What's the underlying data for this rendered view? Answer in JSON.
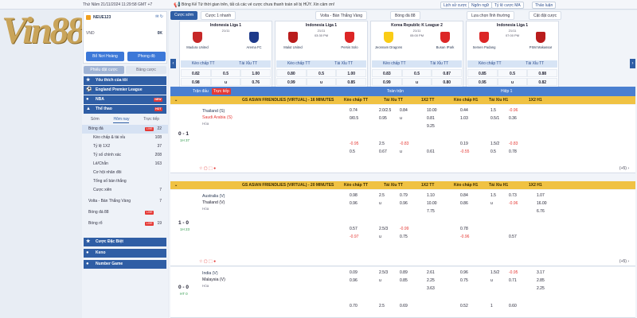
{
  "topbar": {
    "datetime": "Thứ Năm 21/11/2024 11:29:58 GMT +7",
    "announcement": "Bóng Kế Tứ thời gian trên, tất cả các vé cược chưa thanh toán sẽ bị HỦY. Xin cảm ơn!",
    "buttons": [
      "Lịch sử cược",
      "Ngôn ngữ",
      "Tỷ lệ cược MA",
      "Thảo luận"
    ]
  },
  "logo": "Vin88",
  "account": {
    "username": "NEUE123",
    "currency": "VND",
    "balance": "0K",
    "deposit": "Bổ Nơi Hoàng",
    "withdraw": "Phong độ"
  },
  "bet_tabs": [
    "Phiếu đặt cược",
    "Bảng cược"
  ],
  "sidebar": {
    "sections": [
      "Yêu thích của tôi",
      "England Premier League",
      "NBA",
      "Thể thao"
    ],
    "badges": {
      "nba": "NEW",
      "thethao": "HOT"
    },
    "subtabs": [
      "Sớm",
      "Hôm nay",
      "Trực tiếp"
    ],
    "items": [
      {
        "label": "Bóng đá",
        "count": "22",
        "live": "LIVE"
      },
      {
        "label": "Kèo chấp & tài xỉu",
        "count": "108"
      },
      {
        "label": "Tỷ lệ 1X2",
        "count": "37"
      },
      {
        "label": "Tỷ số chính xác",
        "count": "208"
      },
      {
        "label": "Lẻ/Chẵn",
        "count": "163"
      },
      {
        "label": "Cơ hội nhân đôi",
        "count": ""
      },
      {
        "label": "Tổng số bàn thắng",
        "count": ""
      },
      {
        "label": "Cược xiên",
        "count": "7"
      },
      {
        "label": "Volta - Bán Thắng Vàng",
        "count": "7"
      },
      {
        "label": "Bóng đá 88",
        "count": "",
        "live": "LIVE"
      },
      {
        "label": "Bóng rổ",
        "count": "19",
        "live": "LIVE"
      }
    ],
    "bottom": [
      "Cược Đặc Biệt",
      "Keno",
      "Number Game"
    ]
  },
  "main_tabs": {
    "left": "Cược sớm",
    "mid": "Cược 1 nhanh",
    "volta": "Volta - Bàn Thắng Vàng",
    "bongda": "Bóng đá 88",
    "select": "Lựa chọn lĩnh thường",
    "all": "Cật đặt cược"
  },
  "cards": [
    {
      "league": "Indonesia Liga 1",
      "date": "21/11",
      "time": "",
      "home": "Madura United",
      "away": "Arema FC",
      "r1": [
        "0.82",
        "0.5",
        "1.00"
      ],
      "r2": [
        "0.98",
        "u",
        "0.76"
      ],
      "hc": "#c62828",
      "ac": "#1e3a8a"
    },
    {
      "league": "Indonesia Liga 1",
      "date": "21/11",
      "time": "03:30 PM",
      "home": "Malut United",
      "away": "Persis Solo",
      "r1": [
        "0.80",
        "0.5",
        "1.00"
      ],
      "r2": [
        "0.99",
        "u",
        "0.85"
      ],
      "hc": "#b91c1c",
      "ac": "#dc2626"
    },
    {
      "league": "Korea Republic K League 2",
      "date": "21/11",
      "time": "05:00 PM",
      "home": "Jeonnam Dragons",
      "away": "Busan IPark",
      "r1": [
        "0.83",
        "0.5",
        "0.87"
      ],
      "r2": [
        "0.99",
        "u",
        "0.80"
      ],
      "hc": "#facc15",
      "ac": "#dc2626"
    },
    {
      "league": "Indonesia Liga 1",
      "date": "21/11",
      "time": "07:00 PM",
      "home": "Semen Padang",
      "away": "PSM Makassar",
      "r1": [
        "0.85",
        "0.5",
        "0.88"
      ],
      "r2": [
        "0.95",
        "u",
        "0.82"
      ],
      "hc": "#dc2626",
      "ac": "#b91c1c"
    }
  ],
  "card_headers": [
    "Kèo chấp TT",
    "Tài Xỉu TT"
  ],
  "table": {
    "col_match": "Trận đấu",
    "col_live": "Trực tiếp",
    "full": "Toàn trận",
    "half": "Hiệp 1",
    "cols": [
      "Kèo chấp TT",
      "Tài Xỉu TT",
      "1X2 TT",
      "Kèo chấp H1",
      "Tài Xỉu H1",
      "1X2 H1"
    ]
  },
  "leagues": [
    {
      "name": "GS ASIAN FRIENDLIES (VIRTUAL) - 16 MINUTES",
      "home": "Thailand (S)",
      "away": "Saudi Arabia (S)",
      "draw": "Hòa",
      "score": "0 - 1",
      "clock": "1H 37",
      "rows": [
        [
          "0.74",
          "2.0/2.5",
          "0.84",
          "10.00",
          "0.44",
          "1.5",
          "-0.96"
        ],
        [
          "0/0.5",
          "0.95",
          "u",
          "0.81",
          "1.03",
          "0.5/1",
          "0.36"
        ],
        [
          "",
          "",
          "",
          "9.25",
          "",
          "",
          ""
        ],
        [
          "-0.95",
          "2.5",
          "-0.83",
          "",
          "0.19",
          "1.5/2",
          "-0.83"
        ],
        [
          "0.5",
          "0.67",
          "u",
          "0.61",
          "-0.55",
          "0.5",
          "0.78"
        ]
      ]
    },
    {
      "name": "GS ASIAN FRIENDLIES (VIRTUAL) - 20 MINUTES",
      "home": "Australia (V)",
      "away": "Thailand (V)",
      "draw": "Hòa",
      "score": "1 - 0",
      "clock": "1H 23",
      "rows": [
        [
          "0.98",
          "2.5",
          "0.79",
          "1.10",
          "0.84",
          "1.5",
          "0.73",
          "1.07"
        ],
        [
          "0.96",
          "u",
          "0.96",
          "10.00",
          "0.86",
          "u",
          "-0.96",
          "16.00"
        ],
        [
          "",
          "",
          "",
          "7.75",
          "",
          "",
          "",
          "6.76"
        ],
        [
          "0.57",
          "2.5/3",
          "-0.99",
          "",
          "0.78",
          "",
          "",
          ""
        ],
        [
          "-0.97",
          "u",
          "0.75",
          "",
          "-0.96",
          "",
          "0.57",
          ""
        ]
      ]
    },
    {
      "name": "",
      "home": "India (V)",
      "away": "Malaysia (V)",
      "draw": "Hòa",
      "score": "0 - 0",
      "clock": "HT 0",
      "rows": [
        [
          "0.09",
          "2.5/3",
          "0.89",
          "2.61",
          "0.96",
          "1.5/2",
          "-0.95",
          "3.17"
        ],
        [
          "0.96",
          "u",
          "0.85",
          "2.25",
          "0.75",
          "u",
          "0.71",
          "2.85"
        ],
        [
          "",
          "",
          "",
          "3.63",
          "",
          "",
          "",
          "2.25"
        ],
        [
          "0.70",
          "2.5",
          "0.69",
          "",
          "0.52",
          "1",
          "0.60",
          ""
        ]
      ]
    }
  ]
}
